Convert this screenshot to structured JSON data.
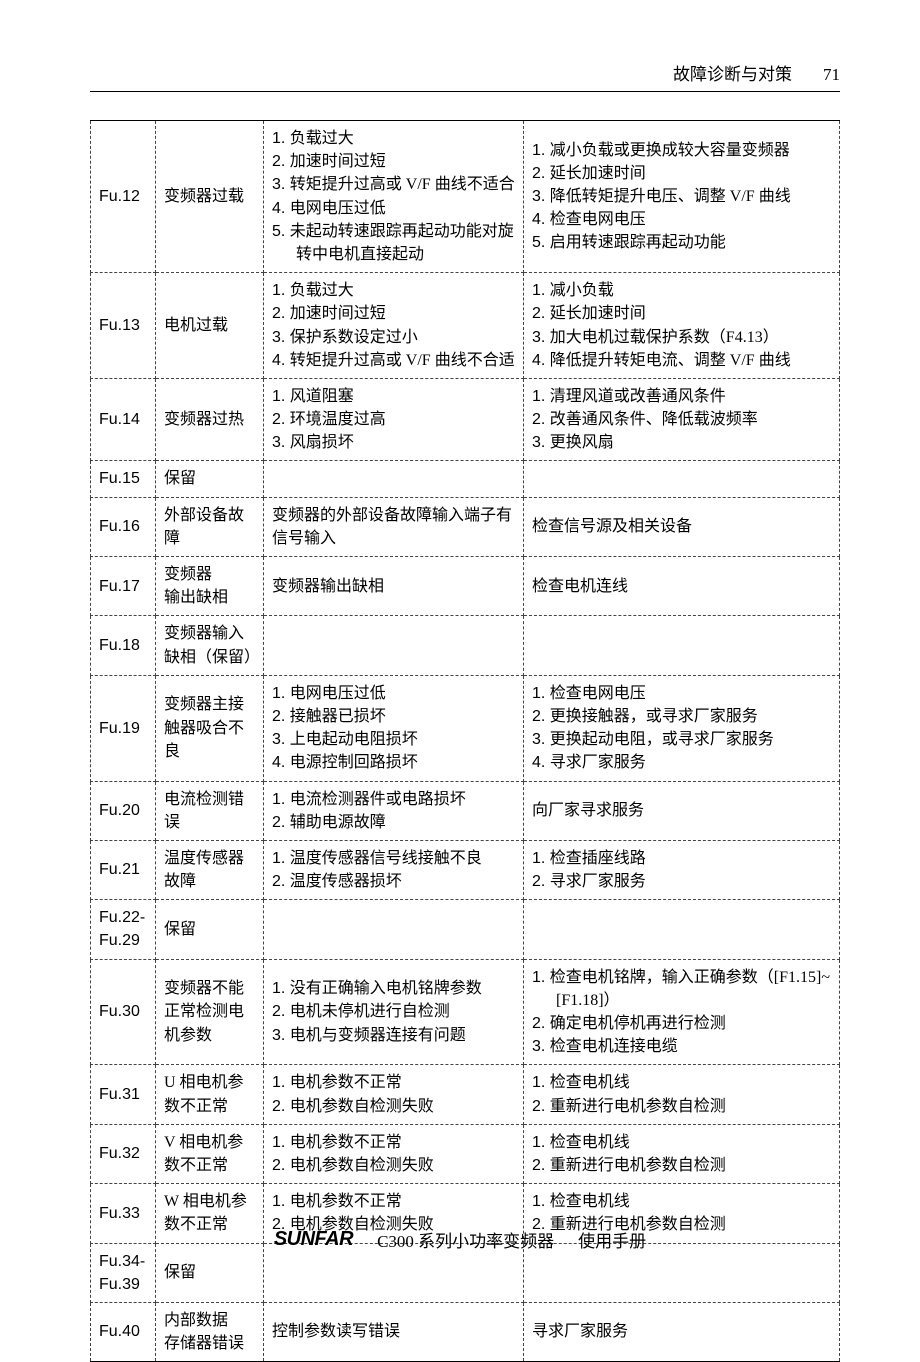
{
  "header": {
    "chapter": "故障诊断与对策",
    "page_no": "71"
  },
  "rows": [
    {
      "code": "Fu.12",
      "name": "变频器过载",
      "cause": [
        "负载过大",
        "加速时间过短",
        "转矩提升过高或 V/F 曲线不适合",
        "电网电压过低",
        "未起动转速跟踪再起动功能对旋转中电机直接起动"
      ],
      "action": [
        "减小负载或更换成较大容量变频器",
        "延长加速时间",
        "降低转矩提升电压、调整 V/F 曲线",
        "检查电网电压",
        "启用转速跟踪再起动功能"
      ]
    },
    {
      "code": "Fu.13",
      "name": "电机过载",
      "cause": [
        "负载过大",
        "加速时间过短",
        "保护系数设定过小",
        "转矩提升过高或 V/F 曲线不合适"
      ],
      "action": [
        "减小负载",
        "延长加速时间",
        "加大电机过载保护系数（F4.13）",
        "降低提升转矩电流、调整 V/F 曲线"
      ]
    },
    {
      "code": "Fu.14",
      "name": "变频器过热",
      "cause": [
        "风道阻塞",
        "环境温度过高",
        "风扇损坏"
      ],
      "action": [
        "清理风道或改善通风条件",
        "改善通风条件、降低载波频率",
        "更换风扇"
      ]
    },
    {
      "code": "Fu.15",
      "name": "保留",
      "cause_text": "",
      "action_text": ""
    },
    {
      "code": "Fu.16",
      "name": "外部设备故障",
      "cause_text": "变频器的外部设备故障输入端子有信号输入",
      "action_text": "检查信号源及相关设备"
    },
    {
      "code": "Fu.17",
      "name": "变频器\n输出缺相",
      "cause_text": "变频器输出缺相",
      "action_text": "检查电机连线"
    },
    {
      "code": "Fu.18",
      "name": "变频器输入\n缺相（保留）",
      "cause_text": "",
      "action_text": ""
    },
    {
      "code": "Fu.19",
      "name": "变频器主接触器吸合不良",
      "cause": [
        "电网电压过低",
        "接触器已损坏",
        "上电起动电阻损坏",
        "电源控制回路损坏"
      ],
      "action": [
        "检查电网电压",
        "更换接触器，或寻求厂家服务",
        "更换起动电阻，或寻求厂家服务",
        "寻求厂家服务"
      ]
    },
    {
      "code": "Fu.20",
      "name": "电流检测错误",
      "cause": [
        "电流检测器件或电路损坏",
        "辅助电源故障"
      ],
      "action_text": "向厂家寻求服务"
    },
    {
      "code": "Fu.21",
      "name": "温度传感器\n故障",
      "cause": [
        "温度传感器信号线接触不良",
        "温度传感器损坏"
      ],
      "action": [
        "检查插座线路",
        "寻求厂家服务"
      ]
    },
    {
      "code": "Fu.22-Fu.29",
      "name": "保留",
      "cause_text": "",
      "action_text": ""
    },
    {
      "code": "Fu.30",
      "name": "变频器不能正常检测电机参数",
      "cause": [
        "没有正确输入电机铭牌参数",
        "电机未停机进行自检测",
        "电机与变频器连接有问题"
      ],
      "action": [
        "检查电机铭牌，输入正确参数（[F1.15]~ [F1.18]）",
        "确定电机停机再进行检测",
        "检查电机连接电缆"
      ]
    },
    {
      "code": "Fu.31",
      "name": "U 相电机参数不正常",
      "cause": [
        "电机参数不正常",
        "电机参数自检测失败"
      ],
      "action": [
        "检查电机线",
        "重新进行电机参数自检测"
      ]
    },
    {
      "code": "Fu.32",
      "name": "V 相电机参数不正常",
      "cause": [
        "电机参数不正常",
        "电机参数自检测失败"
      ],
      "action": [
        "检查电机线",
        "重新进行电机参数自检测"
      ]
    },
    {
      "code": "Fu.33",
      "name": "W 相电机参数不正常",
      "cause": [
        "电机参数不正常",
        "电机参数自检测失败"
      ],
      "action": [
        "检查电机线",
        "重新进行电机参数自检测"
      ]
    },
    {
      "code": "Fu.34-Fu.39",
      "name": "保留",
      "cause_text": "",
      "action_text": ""
    },
    {
      "code": "Fu.40",
      "name": "内部数据\n存储器错误",
      "cause_text": "控制参数读写错误",
      "action_text": "寻求厂家服务"
    }
  ],
  "footer": {
    "logo": "SUNFAR",
    "product": "C300 系列小功率变频器",
    "doc_type": "使用手册"
  }
}
